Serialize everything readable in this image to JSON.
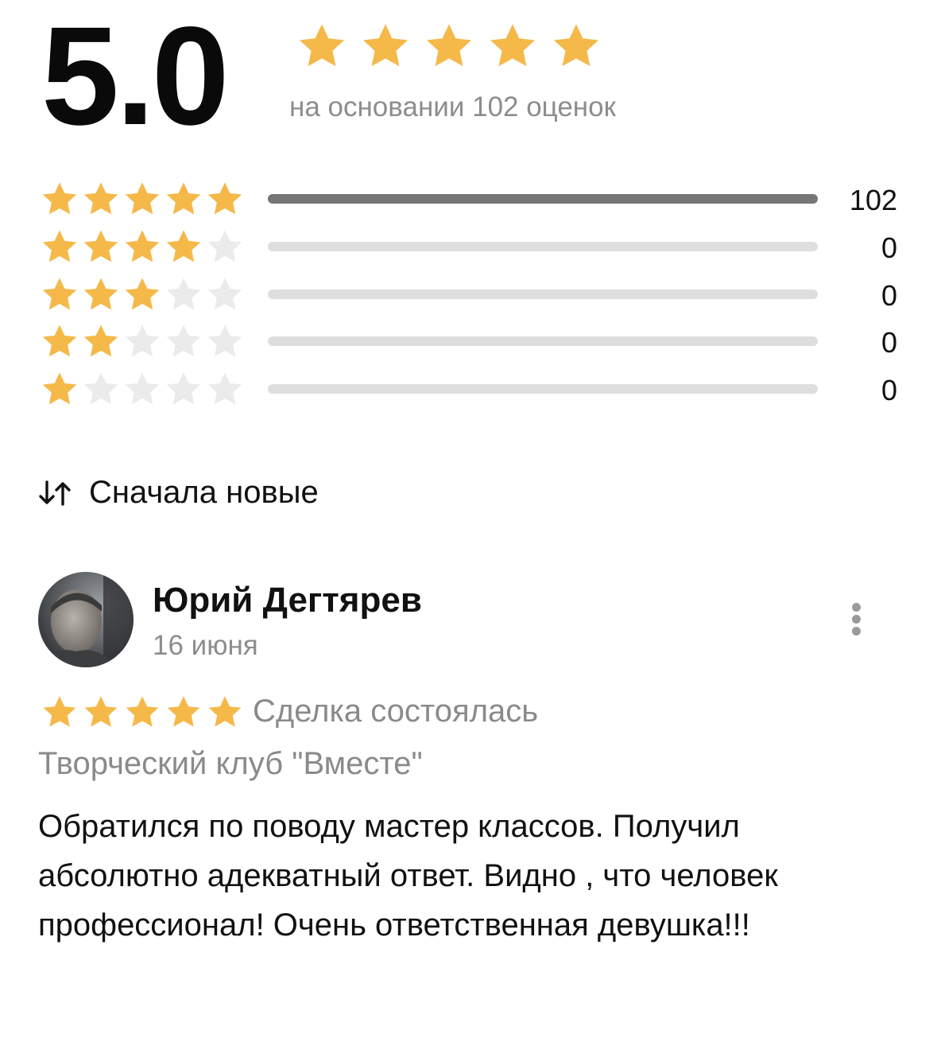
{
  "summary": {
    "score": "5.0",
    "based_on": "на основании 102 оценок",
    "rating_stars": 5
  },
  "breakdown": [
    {
      "stars": 5,
      "count": "102",
      "share": 1.0
    },
    {
      "stars": 4,
      "count": "0",
      "share": 0
    },
    {
      "stars": 3,
      "count": "0",
      "share": 0
    },
    {
      "stars": 2,
      "count": "0",
      "share": 0
    },
    {
      "stars": 1,
      "count": "0",
      "share": 0
    }
  ],
  "sort": {
    "label": "Сначала новые",
    "icon": "sort-arrows-icon"
  },
  "review": {
    "author": "Юрий Дегтярев",
    "date": "16 июня",
    "rating": 5,
    "status": "Сделка состоялась",
    "listing": "Творческий клуб \"Вместе\"",
    "text": "Обратился по поводу мастер классов. Получил абсолютно адекватный ответ. Видно , что человек профессионал! Очень ответственная девушка!!!",
    "menu_icon": "more-vertical-icon"
  },
  "colors": {
    "star_filled": "#F5B94A",
    "star_empty": "#EBEBEB",
    "bar_fill": "#767676",
    "bar_track": "#DEDEDE",
    "muted_text": "#8D8D8D"
  }
}
